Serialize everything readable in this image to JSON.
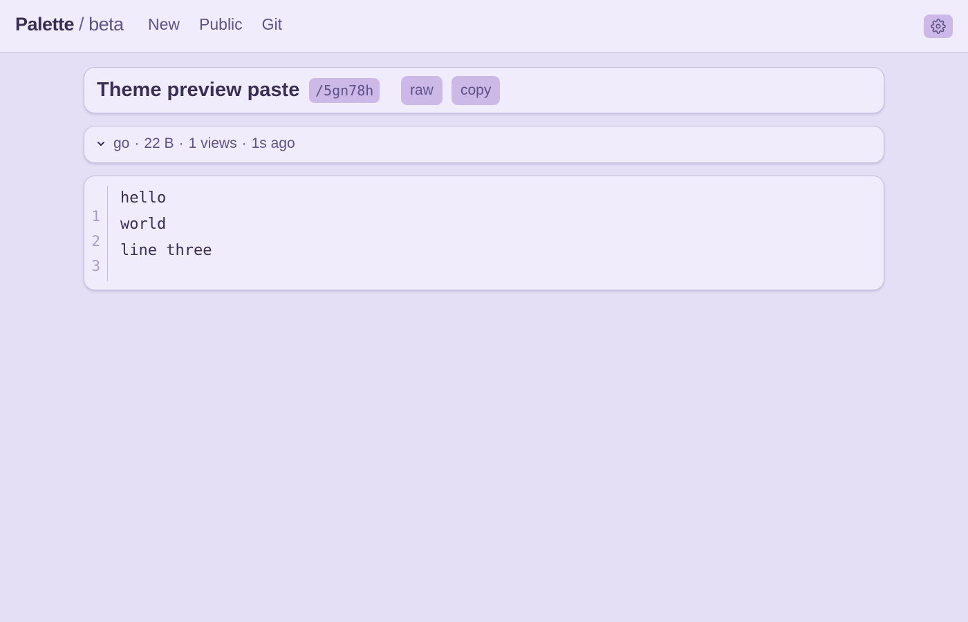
{
  "header": {
    "brand_name": "Palette",
    "brand_separator": "/",
    "brand_tag": "beta",
    "nav": [
      {
        "label": "New"
      },
      {
        "label": "Public"
      },
      {
        "label": "Git"
      }
    ],
    "settings_icon": "gear-icon"
  },
  "paste": {
    "title": "Theme preview paste",
    "slug": "/5gn78h",
    "raw_label": "raw",
    "copy_label": "copy"
  },
  "meta": {
    "toggle_icon": "chevron-down-icon",
    "language": "go",
    "size": "22 B",
    "views": "1 views",
    "age": "1s ago",
    "separator": "·"
  },
  "code": {
    "line_numbers": [
      "1",
      "2",
      "3"
    ],
    "lines": [
      "hello",
      "world",
      "line three"
    ]
  },
  "colors": {
    "background": "#e4dff4",
    "surface": "#f0ecfb",
    "accent": "#ccb9e8",
    "text": "#3a2f52",
    "muted": "#5e5286"
  }
}
